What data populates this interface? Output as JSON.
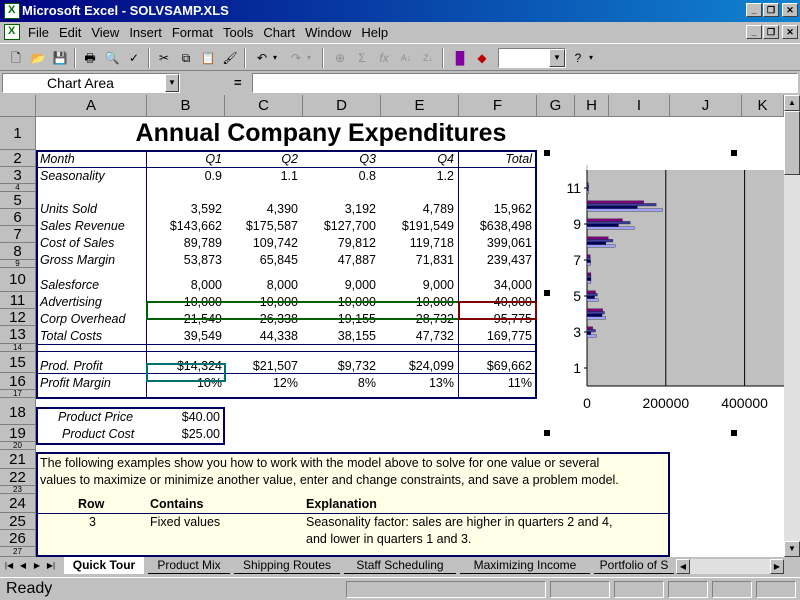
{
  "window": {
    "app_title": "Microsoft Excel - SOLVSAMP.XLS"
  },
  "menu": [
    "File",
    "Edit",
    "View",
    "Insert",
    "Format",
    "Tools",
    "Chart",
    "Window",
    "Help"
  ],
  "formula_bar": {
    "name_box": "Chart Area",
    "eq": "=",
    "formula": ""
  },
  "columns": [
    "A",
    "B",
    "C",
    "D",
    "E",
    "F",
    "G",
    "H",
    "I",
    "J",
    "K"
  ],
  "rows": [
    "1",
    "2",
    "3",
    "4",
    "5",
    "6",
    "7",
    "8",
    "9",
    "10",
    "11",
    "12",
    "13",
    "14",
    "15",
    "16",
    "17",
    "18",
    "19",
    "20",
    "21",
    "22",
    "23",
    "24",
    "25",
    "26",
    "27"
  ],
  "sheet": {
    "title": "Annual Company Expenditures",
    "header": {
      "label": "Month",
      "cols": [
        "Q1",
        "Q2",
        "Q3",
        "Q4",
        "Total"
      ]
    },
    "table": [
      {
        "label": "Seasonality",
        "values": [
          "0.9",
          "1.1",
          "0.8",
          "1.2",
          ""
        ]
      },
      {
        "label": "Units Sold",
        "values": [
          "3,592",
          "4,390",
          "3,192",
          "4,789",
          "15,962"
        ]
      },
      {
        "label": "Sales Revenue",
        "values": [
          "$143,662",
          "$175,587",
          "$127,700",
          "$191,549",
          "$638,498"
        ]
      },
      {
        "label": "Cost of Sales",
        "values": [
          "89,789",
          "109,742",
          "79,812",
          "119,718",
          "399,061"
        ]
      },
      {
        "label": "Gross Margin",
        "values": [
          "53,873",
          "65,845",
          "47,887",
          "71,831",
          "239,437"
        ]
      },
      {
        "label": "Salesforce",
        "values": [
          "8,000",
          "8,000",
          "9,000",
          "9,000",
          "34,000"
        ]
      },
      {
        "label": "Advertising",
        "values": [
          "10,000",
          "10,000",
          "10,000",
          "10,000",
          "40,000"
        ]
      },
      {
        "label": "Corp Overhead",
        "values": [
          "21,549",
          "26,338",
          "19,155",
          "28,732",
          "95,775"
        ]
      },
      {
        "label": "Total Costs",
        "values": [
          "39,549",
          "44,338",
          "38,155",
          "47,732",
          "169,775"
        ]
      },
      {
        "label": "Prod. Profit",
        "values": [
          "$14,324",
          "$21,507",
          "$9,732",
          "$24,099",
          "$69,662"
        ]
      },
      {
        "label": "Profit Margin",
        "values": [
          "10%",
          "12%",
          "8%",
          "13%",
          "11%"
        ]
      }
    ],
    "price": {
      "label": "Product Price",
      "value": "$40.00"
    },
    "cost": {
      "label": "Product Cost",
      "value": "$25.00"
    },
    "notes": {
      "intro_line1": "The following examples show you how to work with the model above to solve for one value or several",
      "intro_line2": "values to maximize or minimize another value, enter and change constraints, and save a problem model.",
      "headers": [
        "Row",
        "Contains",
        "Explanation"
      ],
      "row": {
        "num": "3",
        "contains": "Fixed values",
        "expl1": "Seasonality factor:  sales are higher in quarters 2 and 4,",
        "expl2": "and lower in quarters 1 and 3."
      }
    }
  },
  "chart_data": {
    "type": "bar",
    "orientation": "horizontal",
    "y_ticks": [
      "1",
      "3",
      "5",
      "7",
      "9",
      "11"
    ],
    "x_ticks": [
      "0",
      "200000",
      "400000"
    ],
    "xlim": [
      0,
      500000
    ],
    "ylim": [
      0,
      12
    ],
    "series_colors": [
      "#800080",
      "#4040a0",
      "#000060",
      "#a0a0ff"
    ],
    "rows": [
      {
        "y": 1,
        "values": [
          0,
          0,
          0,
          0
        ]
      },
      {
        "y": 2,
        "values": [
          10,
          12,
          8,
          13
        ]
      },
      {
        "y": 3,
        "values": [
          14324,
          21507,
          9732,
          24099
        ]
      },
      {
        "y": 4,
        "values": [
          39549,
          44338,
          38155,
          47732
        ]
      },
      {
        "y": 5,
        "values": [
          21549,
          26338,
          19155,
          28732
        ]
      },
      {
        "y": 6,
        "values": [
          10000,
          10000,
          10000,
          10000
        ]
      },
      {
        "y": 7,
        "values": [
          8000,
          8000,
          9000,
          9000
        ]
      },
      {
        "y": 8,
        "values": [
          53873,
          65845,
          47887,
          71831
        ]
      },
      {
        "y": 9,
        "values": [
          89789,
          109742,
          79812,
          119718
        ]
      },
      {
        "y": 10,
        "values": [
          143662,
          175587,
          127700,
          191549
        ]
      },
      {
        "y": 11,
        "values": [
          3592,
          4390,
          3192,
          4789
        ]
      },
      {
        "y": 12,
        "values": [
          0.9,
          1.1,
          0.8,
          1.2
        ]
      }
    ]
  },
  "tabs": [
    "Quick Tour",
    "Product Mix",
    "Shipping Routes",
    "Staff Scheduling",
    "Maximizing Income",
    "Portfolio of S"
  ],
  "status": {
    "text": "Ready"
  }
}
